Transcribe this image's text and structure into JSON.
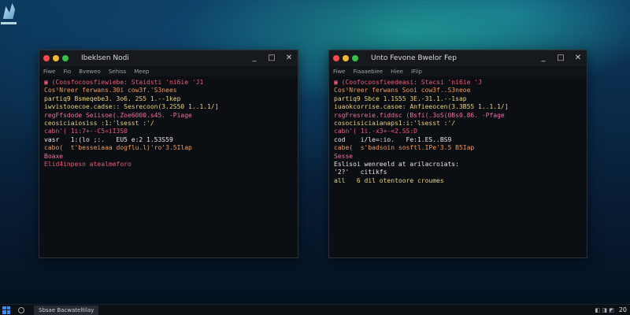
{
  "windows": [
    {
      "title": "Ibeklsen Nodi",
      "controls": {
        "minimize": "_",
        "maximize": "□",
        "close": "✕"
      },
      "menu": [
        "Fiwe",
        "Fio",
        "Bveweo",
        "Sehiss",
        "Meep"
      ],
      "lines": [
        {
          "text": "▣ (Coosfocoosfiewiebe: Staidsti 'ni6ie 'J1",
          "color": "#f05a7a"
        },
        {
          "text": "Cos⁵Nreer ferwans.30i cow3f.'S3nees",
          "color": "#f09a5a"
        },
        {
          "text": "partiq9 Bsmeqebe3. 3o6. 2S5 1.--1kep",
          "color": "#e8d27a"
        },
        {
          "text": "iwvistooecoe.cadse:: Sesrecoon(3.2S50 1..1.1/]",
          "color": "#e8d27a"
        },
        {
          "text": "regFfsdode Seiisoe(.Zoe6000.s45. -Piage",
          "color": "#f06fa5"
        },
        {
          "text": "ceosiciaiosiss :1:'lsesst :'/",
          "color": "#e8d27a"
        },
        {
          "text": "cabn'( 1i:7+--C5=iI3S0",
          "color": "#f05a7a"
        },
        {
          "text": "vasr   1:(lo ;:.   EU5 e:2 1.53S59",
          "color": "#e8e8e8"
        },
        {
          "text": "cabo(  t'besseiaaa dogflu.l)'ro'3.5Ilap",
          "color": "#f09a5a"
        },
        {
          "text": "Boaxe",
          "color": "#f06fa5"
        },
        {
          "text": "Elid4inpesn atealmeforo",
          "color": "#f05a7a"
        }
      ]
    },
    {
      "title": "Unto Fevone Bwelor Fep",
      "controls": {
        "minimize": "_",
        "maximize": "□",
        "close": "✕"
      },
      "menu": [
        "Fiwe",
        "Fiaaaebiee",
        "Hiee",
        "IFiip"
      ],
      "lines": [
        {
          "text": "▣ (Coofocoosfieedeasi: Stacsi 'ni6ie 'J",
          "color": "#f05a7a"
        },
        {
          "text": "Cos⁵Nreer ferwans Sooi cow3f..S3neoe",
          "color": "#f09a5a"
        },
        {
          "text": "partiq9 Sbce 1.1S55 3E.-31.1.--1sap",
          "color": "#e8d27a"
        },
        {
          "text": "iuaokcorrise.casoe: Anfieeocen(3.3B55 1..1.1/]",
          "color": "#e8d27a"
        },
        {
          "text": "rsgFresreie.fiddsc (Bsfi(.3oS(0Bs0.86. -Pfage",
          "color": "#f06fa5"
        },
        {
          "text": "cosocisiciaianaps1:i:'lsesst :'/",
          "color": "#e8d27a"
        },
        {
          "text": "cabn'( 1i.-x3+-<2.SS:D",
          "color": "#f05a7a"
        },
        {
          "text": "cod    i/le=:io.   Fe:1.ES..BS9",
          "color": "#e8e8e8"
        },
        {
          "text": "cabe(  s'badsoin sosftl.IPe'3.5 B5Iap",
          "color": "#f09a5a"
        },
        {
          "text": "Sesse",
          "color": "#f06fa5"
        },
        {
          "text": "Eslisoi wenreeld at arilacroiats:",
          "color": "#e8e8e8"
        },
        {
          "text": "'2?'   citikfs",
          "color": "#e8e8e8"
        },
        {
          "text": "all   6 dil otentoore croumes",
          "color": "#e8d27a"
        }
      ]
    }
  ],
  "taskbar": {
    "search_icon": "search-icon",
    "active_task": "Sbsae Bacwateltilay",
    "tray_icons": "◧ ◨ ◩",
    "clock": "20"
  }
}
